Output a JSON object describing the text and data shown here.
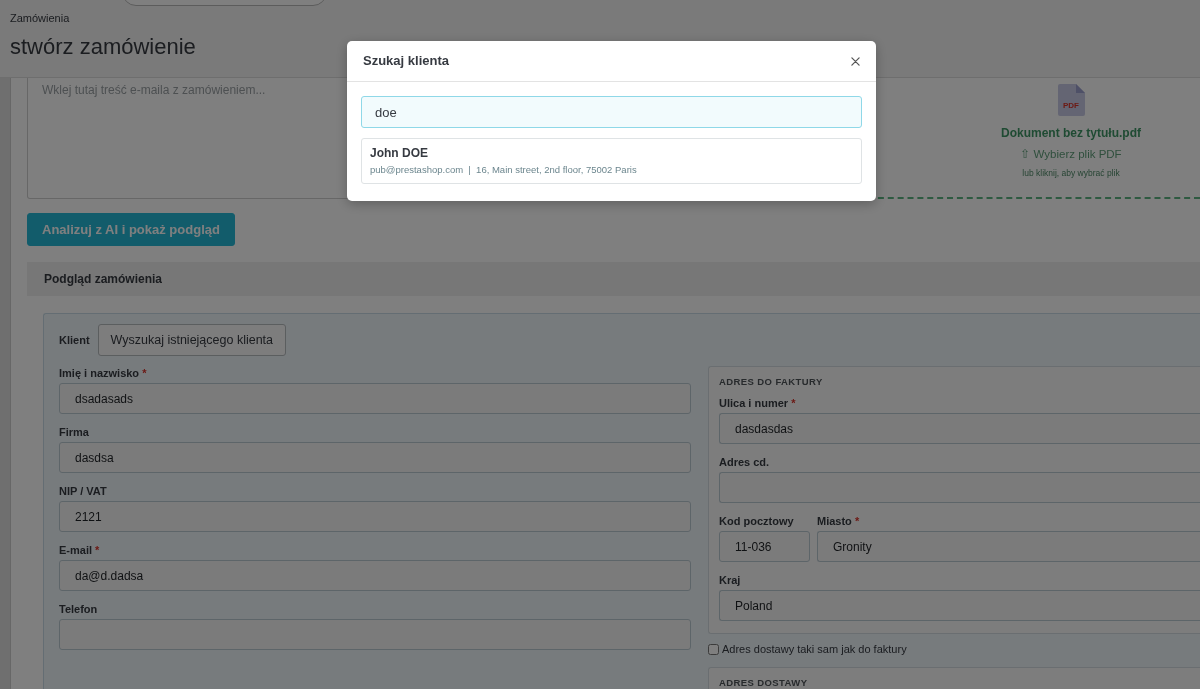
{
  "header": {
    "breadcrumb": "Zamówienia",
    "title": "stwórz zamówienie"
  },
  "order_email": {
    "placeholder": "Wklej tutaj treść e-maila z zamówieniem..."
  },
  "pdf_upload": {
    "icon_label": "PDF",
    "file_name": "Dokument bez tytułu.pdf",
    "action": "⇧ Wybierz plik PDF",
    "hint": "lub kliknij, aby wybrać plik"
  },
  "analyze_button": {
    "label": "Analizuj z AI i pokaż podgląd"
  },
  "preview": {
    "title": "Podgląd zamówienia",
    "client_label": "Klient",
    "search_button": "Wyszukaj istniejącego klienta",
    "customer_fields": [
      {
        "label": "Imię i nazwisko",
        "required_mark": "*",
        "value": "dsadasads"
      },
      {
        "label": "Firma",
        "value": "dasdsa"
      },
      {
        "label": "NIP / VAT",
        "value": "2121"
      },
      {
        "label": "E-mail",
        "required_mark": "*",
        "value": "da@d.dadsa"
      },
      {
        "label": "Telefon"
      }
    ],
    "billing_address": {
      "title": "ADRES DO FAKTURY",
      "rows": [
        {
          "fields": [
            {
              "label": "Ulica i numer",
              "required_mark": "*",
              "value": "dasdasdas"
            }
          ]
        },
        {
          "fields": [
            {
              "label": "Adres cd."
            }
          ]
        },
        {
          "fields": [
            {
              "label": "Kod pocztowy",
              "value": "11-036"
            },
            {
              "label": "Miasto",
              "required_mark": "*",
              "value": "Gronity"
            }
          ]
        },
        {
          "fields": [
            {
              "label": "Kraj",
              "value": "Poland"
            }
          ]
        }
      ]
    },
    "same_as_billing": {
      "label": "Adres dostawy taki sam jak do faktury",
      "checked": false
    },
    "shipping_address": {
      "title": "ADRES DOSTAWY"
    }
  },
  "customer_search_dialog": {
    "title": "Szukaj klienta",
    "query": {
      "value": "doe"
    },
    "results": [
      {
        "name": "John DOE",
        "detail": "pub@prestashop.com  |  16, Main street, 2nd floor, 75002 Paris"
      }
    ]
  }
}
